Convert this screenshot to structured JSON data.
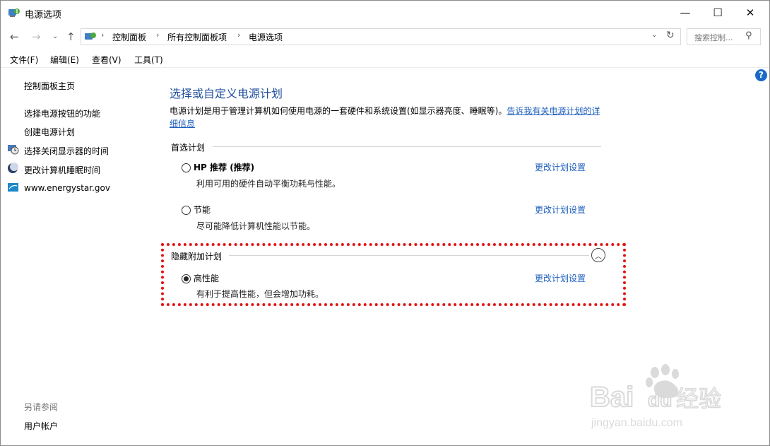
{
  "window": {
    "title": "电源选项",
    "icon": "power-options-icon"
  },
  "titlebar_buttons": {
    "minimize": "—",
    "maximize": "☐",
    "close": "✕"
  },
  "address": {
    "back": "←",
    "forward": "→",
    "history": "⌄",
    "up": "↑",
    "crumbs": [
      "控制面板",
      "所有控制面板项",
      "电源选项"
    ],
    "separator": "›",
    "dropdown": "⌄",
    "refresh": "↻",
    "search_placeholder": "搜索控制..."
  },
  "menu": [
    "文件(F)",
    "编辑(E)",
    "查看(V)",
    "工具(T)"
  ],
  "sidebar": {
    "home": "控制面板主页",
    "links": [
      {
        "label": "选择电源按钮的功能",
        "icon": ""
      },
      {
        "label": "创建电源计划",
        "icon": ""
      },
      {
        "label": "选择关闭显示器的时间",
        "icon": "monitor-clock-icon"
      },
      {
        "label": "更改计算机睡眠时间",
        "icon": "moon-icon"
      },
      {
        "label": "www.energystar.gov",
        "icon": "energystar-icon"
      }
    ],
    "see_also": "另请参阅",
    "user_accounts": "用户帐户"
  },
  "main": {
    "title": "选择或自定义电源计划",
    "description": "电源计划是用于管理计算机如何使用电源的一套硬件和系统设置(如显示器亮度、睡眠等)。",
    "description_link": "告诉我有关电源计划的详细信息",
    "preferred_label": "首选计划",
    "hidden_label": "隐藏附加计划",
    "change_label": "更改计划设置",
    "plans": [
      {
        "name": "HP 推荐 (推荐)",
        "desc": "利用可用的硬件自动平衡功耗与性能。",
        "selected": false
      },
      {
        "name": "节能",
        "desc": "尽可能降低计算机性能以节能。",
        "selected": false
      },
      {
        "name": "高性能",
        "desc": "有利于提高性能，但会增加功耗。",
        "selected": true
      }
    ]
  },
  "colors": {
    "link": "#1f5fbd",
    "title": "#1f4e9e",
    "highlight": "#e01515",
    "help": "#1b6ac9"
  },
  "watermark": {
    "brand": "Bai",
    "brand2": "du",
    "cn": "经验",
    "url": "jingyan.baidu.com"
  }
}
